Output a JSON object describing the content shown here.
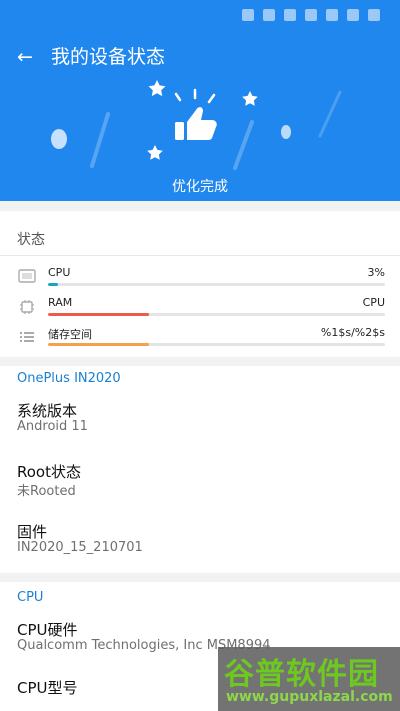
{
  "header": {
    "title": "我的设备状态",
    "done_text": "优化完成",
    "back_icon": "arrow-left-icon",
    "hero_icon": "thumbs-up-icon",
    "accent_color": "#1f87ee"
  },
  "status": {
    "heading": "状态",
    "resources": [
      {
        "label": "CPU",
        "value": "3%",
        "fill": 0.03,
        "icon": "display-icon",
        "color": "#17a7b8"
      },
      {
        "label": "RAM",
        "value": "CPU",
        "fill": 0.3,
        "icon": "chip-icon",
        "color": "#ec5c4a"
      },
      {
        "label": "储存空间",
        "value": "%1$s/%2$s",
        "fill": 0.3,
        "icon": "storage-list-icon",
        "color": "#f4a14e"
      }
    ]
  },
  "device": {
    "group_title": "OnePlus IN2020",
    "items": [
      {
        "title": "系统版本",
        "value": "Android 11"
      },
      {
        "title": "Root状态",
        "value": "未Rooted"
      },
      {
        "title": "固件",
        "value": "IN2020_15_210701"
      }
    ]
  },
  "cpu": {
    "group_title": "CPU",
    "items": [
      {
        "title": "CPU硬件",
        "value": "Qualcomm Technologies, Inc MSM8994"
      },
      {
        "title": "CPU型号",
        "value": ""
      }
    ]
  },
  "watermark": {
    "main": "谷普软件园",
    "sub": "www.gupuxlazal.com"
  }
}
